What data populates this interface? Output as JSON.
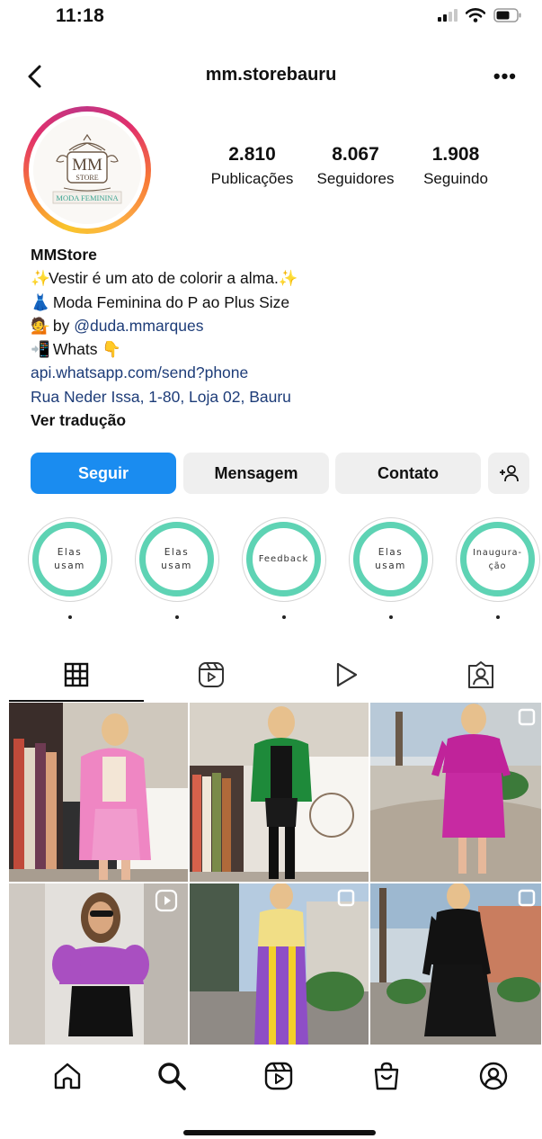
{
  "status": {
    "time": "11:18"
  },
  "header": {
    "username": "mm.storebauru",
    "more_label": "•••"
  },
  "profile": {
    "logo": {
      "line1": "MM",
      "line2": "STORE",
      "line3": "MODA FEMININA"
    },
    "stats": [
      {
        "count": "2.810",
        "label": "Publicações"
      },
      {
        "count": "8.067",
        "label": "Seguidores"
      },
      {
        "count": "1.908",
        "label": "Seguindo"
      }
    ]
  },
  "bio": {
    "name": "MMStore",
    "line1": "Vestir é um ato de colorir a alma.",
    "line2": "Moda Feminina do P ao Plus Size",
    "line3_prefix": "by ",
    "line3_mention": "@duda.mmarques",
    "line4": "Whats",
    "link": "api.whatsapp.com/send?phone",
    "address": "Rua Neder Issa, 1-80, Loja 02, Bauru",
    "translate": "Ver tradução"
  },
  "actions": {
    "follow": "Seguir",
    "message": "Mensagem",
    "contact": "Contato",
    "add_person": "+Ɑ"
  },
  "highlights": [
    {
      "line1": "Elas",
      "line2": "usam"
    },
    {
      "line1": "Elas",
      "line2": "usam"
    },
    {
      "line1": "Feedback",
      "line2": ""
    },
    {
      "line1": "Elas",
      "line2": "usam"
    },
    {
      "line1": "Inaugura-",
      "line2": "ção"
    }
  ],
  "colors": {
    "follow_button": "#1a8cf0",
    "secondary_button": "#efefef",
    "highlight_ring": "#5ed3b4",
    "link": "#1d3c78"
  },
  "tabs": [
    "grid-icon",
    "reels-icon",
    "video-icon",
    "tagged-icon"
  ],
  "nav": [
    "home-icon",
    "search-icon",
    "reels-icon",
    "shop-icon",
    "profile-icon"
  ]
}
